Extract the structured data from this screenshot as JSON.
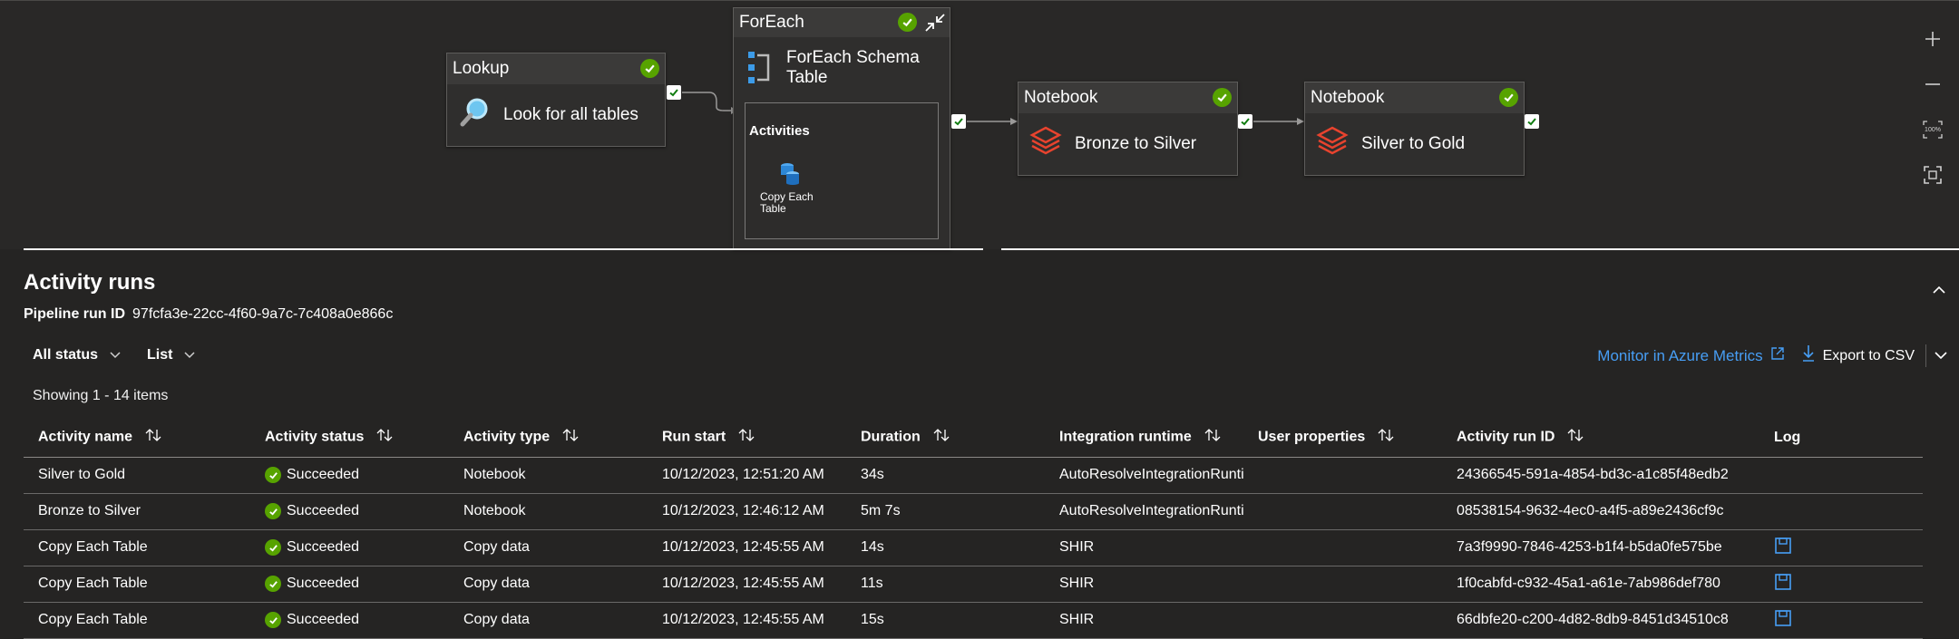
{
  "pipeline": {
    "lookup": {
      "header": "Lookup",
      "label": "Look for all tables"
    },
    "foreach": {
      "header": "ForEach",
      "label_line1": "ForEach Schema",
      "label_line2": "Table",
      "activities_title": "Activities",
      "inner_line1": "Copy Each",
      "inner_line2": "Table"
    },
    "notebook1": {
      "header": "Notebook",
      "label": "Bronze to Silver"
    },
    "notebook2": {
      "header": "Notebook",
      "label": "Silver to Gold"
    },
    "zoom_label": "100%"
  },
  "panel": {
    "title": "Activity runs",
    "run_id_label": "Pipeline run ID",
    "run_id": "97fcfa3e-22cc-4f60-9a7c-7c408a0e866c",
    "filter_status": "All status",
    "filter_view": "List",
    "showing": "Showing 1 - 14 items",
    "monitor_link": "Monitor in Azure Metrics",
    "export": "Export to CSV"
  },
  "columns": {
    "name": "Activity name",
    "status": "Activity status",
    "type": "Activity type",
    "start": "Run start",
    "duration": "Duration",
    "runtime": "Integration runtime",
    "props": "User properties",
    "runid": "Activity run ID",
    "log": "Log"
  },
  "rows": [
    {
      "name": "Silver to Gold",
      "status": "Succeeded",
      "type": "Notebook",
      "start": "10/12/2023, 12:51:20 AM",
      "duration": "34s",
      "runtime": "AutoResolveIntegrationRunti",
      "runid": "24366545-591a-4854-bd3c-a1c85f48edb2"
    },
    {
      "name": "Bronze to Silver",
      "status": "Succeeded",
      "type": "Notebook",
      "start": "10/12/2023, 12:46:12 AM",
      "duration": "5m 7s",
      "runtime": "AutoResolveIntegrationRunti",
      "runid": "08538154-9632-4ec0-a4f5-a89e2436cf9c"
    },
    {
      "name": "Copy Each Table",
      "status": "Succeeded",
      "type": "Copy data",
      "start": "10/12/2023, 12:45:55 AM",
      "duration": "14s",
      "runtime": "SHIR",
      "runid": "7a3f9990-7846-4253-b1f4-b5da0fe575be"
    },
    {
      "name": "Copy Each Table",
      "status": "Succeeded",
      "type": "Copy data",
      "start": "10/12/2023, 12:45:55 AM",
      "duration": "11s",
      "runtime": "SHIR",
      "runid": "1f0cabfd-c932-45a1-a61e-7ab986def780"
    },
    {
      "name": "Copy Each Table",
      "status": "Succeeded",
      "type": "Copy data",
      "start": "10/12/2023, 12:45:55 AM",
      "duration": "15s",
      "runtime": "SHIR",
      "runid": "66dbfe20-c200-4d82-8db9-8451d34510c8"
    }
  ],
  "colors": {
    "success": "#57a300",
    "link": "#479ef5",
    "databricks": "#e8432e"
  }
}
